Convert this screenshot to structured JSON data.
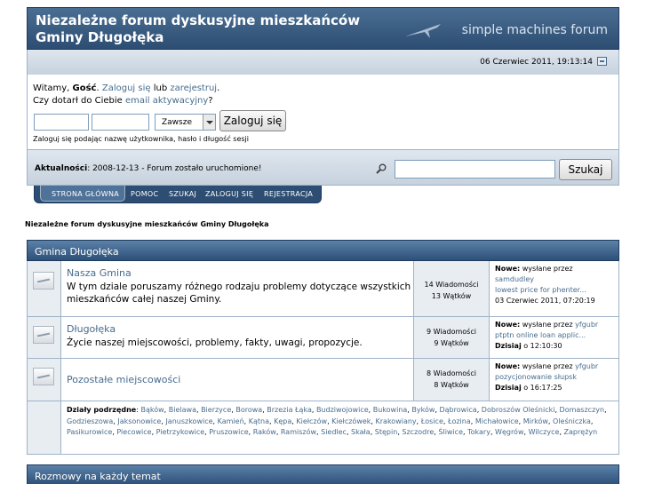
{
  "header": {
    "title": "Niezależne forum dyskusyjne mieszkańców Gminy Długołęka",
    "logo_text": "simple machines forum"
  },
  "datebar": {
    "date": "06 Czerwiec 2011, 19:13:14"
  },
  "userbox": {
    "welcome": "Witamy,",
    "guest": "Gość",
    "login_link": "Zaloguj się",
    "or": "lub",
    "register_link": "zarejestruj",
    "missed": "Czy dotarł do Ciebie",
    "activation_link": "email aktywacyjny",
    "duration_option": "Zawsze",
    "login_button": "Zaloguj się",
    "hint": "Zaloguj się podając nazwę użytkownika, hasło i długość sesji"
  },
  "news": {
    "label": "Aktualności",
    "text": ": 2008-12-13 - Forum zostało uruchomione!",
    "search_button": "Szukaj"
  },
  "menu": [
    "STRONA GŁÓWNA",
    "POMOC",
    "SZUKAJ",
    "ZALOGUJ SIĘ",
    "REJESTRACJA"
  ],
  "breadcrumb": "Niezależne forum dyskusyjne mieszkańców Gminy Długołęka",
  "categories": [
    {
      "title": "Gmina Długołęka",
      "boards": [
        {
          "name": "Nasza Gmina",
          "desc": "W tym dziale poruszamy różnego rodzaju problemy dotyczące wszystkich mieszkańców całej naszej Gminy.",
          "posts": "14 Wiadomości",
          "topics": "13 Wątków",
          "new_label": "Nowe:",
          "by": "wysłane przez",
          "author": "",
          "author_line": "samdudley",
          "topic": "lowest price for phenter...",
          "time_bold": "",
          "time": "03 Czerwiec 2011, 07:20:19"
        },
        {
          "name": "Długołęka",
          "desc": "Życie naszej miejscowości, problemy, fakty, uwagi, propozycje.",
          "posts": "9 Wiadomości",
          "topics": "9 Wątków",
          "new_label": "Nowe:",
          "by": "wysłane przez",
          "author": "yfgubr",
          "author_line": "",
          "topic": "ptptn online loan applic...",
          "time_bold": "Dzisiaj",
          "time": "o 12:10:30"
        },
        {
          "name": "Pozostałe miejscowości",
          "desc": "",
          "posts": "8 Wiadomości",
          "topics": "8 Wątków",
          "new_label": "Nowe:",
          "by": "wysłane przez",
          "author": "yfgubr",
          "author_line": "",
          "topic": "pozycjonowanie słupsk",
          "time_bold": "Dzisiaj",
          "time": "o 16:17:25"
        }
      ],
      "subboards_label": "Działy podrzędne",
      "subboards": [
        "Bąków",
        "Bielawa",
        "Bierzyce",
        "Borowa",
        "Brzezia Łąka",
        "Budziwojowice",
        "Bukowina",
        "Byków",
        "Dąbrowica",
        "Dobroszów Oleśnicki",
        "Domaszczyn",
        "Godzieszowa",
        "Jaksonowice",
        "Januszkowice",
        "Kamień",
        "Kątna",
        "Kępa",
        "Kiełczów",
        "Kiełczówek",
        "Krakowiany",
        "Łosice",
        "Łozina",
        "Michałowice",
        "Mirków",
        "Oleśniczka",
        "Pasikurowice",
        "Piecowice",
        "Pietrzykowice",
        "Pruszowice",
        "Raków",
        "Ramiszów",
        "Siedlec",
        "Skała",
        "Stępin",
        "Szczodre",
        "Śliwice",
        "Tokary",
        "Węgrów",
        "Wilczyce",
        "Zaprężyn"
      ]
    },
    {
      "title": "Rozmowy na każdy temat"
    }
  ]
}
